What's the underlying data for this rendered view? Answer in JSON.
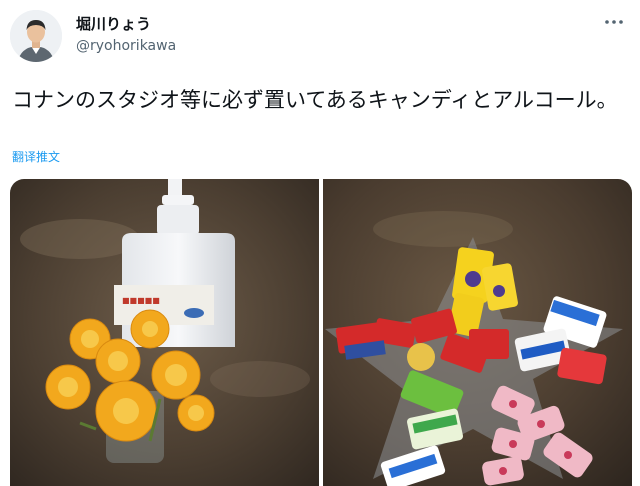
{
  "user": {
    "display_name": "堀川りょう",
    "handle": "@ryohorikawa",
    "avatar_icon": "avatar-photo"
  },
  "more_icon": "three-dots-icon",
  "tweet": {
    "text": "コナンのスタジオ等に必ず置いてあるキャンディとアルコール。",
    "translate_label": "翻译推文"
  },
  "media": {
    "left_photo": "hand-sanitizer-bottle-and-yellow-flowers",
    "right_photo": "star-shaped-plate-of-wrapped-candies"
  },
  "colors": {
    "link": "#1d9bf0",
    "text": "#0f1419",
    "secondary": "#536471"
  }
}
